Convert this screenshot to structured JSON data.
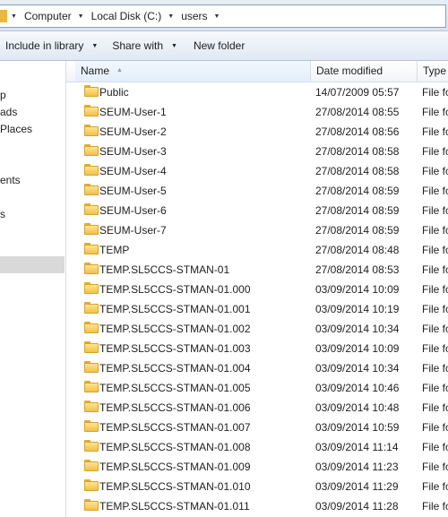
{
  "address": {
    "crumbs": [
      "Computer",
      "Local Disk (C:)",
      "users"
    ]
  },
  "toolbar": {
    "include_label": "Include in library",
    "share_label": "Share with",
    "newfolder_label": "New folder"
  },
  "nav": {
    "items": [
      "p",
      "ads",
      "Places",
      "ents",
      "s"
    ]
  },
  "columns": {
    "name": "Name",
    "date": "Date modified",
    "type": "Type"
  },
  "rows": [
    {
      "name": "Public",
      "date": "14/07/2009 05:57",
      "type": "File fo"
    },
    {
      "name": "SEUM-User-1",
      "date": "27/08/2014 08:55",
      "type": "File fo"
    },
    {
      "name": "SEUM-User-2",
      "date": "27/08/2014 08:56",
      "type": "File fo"
    },
    {
      "name": "SEUM-User-3",
      "date": "27/08/2014 08:58",
      "type": "File fo"
    },
    {
      "name": "SEUM-User-4",
      "date": "27/08/2014 08:58",
      "type": "File fo"
    },
    {
      "name": "SEUM-User-5",
      "date": "27/08/2014 08:59",
      "type": "File fo"
    },
    {
      "name": "SEUM-User-6",
      "date": "27/08/2014 08:59",
      "type": "File fo"
    },
    {
      "name": "SEUM-User-7",
      "date": "27/08/2014 08:59",
      "type": "File fo"
    },
    {
      "name": "TEMP",
      "date": "27/08/2014 08:48",
      "type": "File fo"
    },
    {
      "name": "TEMP.SL5CCS-STMAN-01",
      "date": "27/08/2014 08:53",
      "type": "File fo"
    },
    {
      "name": "TEMP.SL5CCS-STMAN-01.000",
      "date": "03/09/2014 10:09",
      "type": "File fo"
    },
    {
      "name": "TEMP.SL5CCS-STMAN-01.001",
      "date": "03/09/2014 10:19",
      "type": "File fo"
    },
    {
      "name": "TEMP.SL5CCS-STMAN-01.002",
      "date": "03/09/2014 10:34",
      "type": "File fo"
    },
    {
      "name": "TEMP.SL5CCS-STMAN-01.003",
      "date": "03/09/2014 10:09",
      "type": "File fo"
    },
    {
      "name": "TEMP.SL5CCS-STMAN-01.004",
      "date": "03/09/2014 10:34",
      "type": "File fo"
    },
    {
      "name": "TEMP.SL5CCS-STMAN-01.005",
      "date": "03/09/2014 10:46",
      "type": "File fo"
    },
    {
      "name": "TEMP.SL5CCS-STMAN-01.006",
      "date": "03/09/2014 10:48",
      "type": "File fo"
    },
    {
      "name": "TEMP.SL5CCS-STMAN-01.007",
      "date": "03/09/2014 10:59",
      "type": "File fo"
    },
    {
      "name": "TEMP.SL5CCS-STMAN-01.008",
      "date": "03/09/2014 11:14",
      "type": "File fo"
    },
    {
      "name": "TEMP.SL5CCS-STMAN-01.009",
      "date": "03/09/2014 11:23",
      "type": "File fo"
    },
    {
      "name": "TEMP.SL5CCS-STMAN-01.010",
      "date": "03/09/2014 11:29",
      "type": "File fo"
    },
    {
      "name": "TEMP.SL5CCS-STMAN-01.011",
      "date": "03/09/2014 11:28",
      "type": "File fo"
    }
  ]
}
